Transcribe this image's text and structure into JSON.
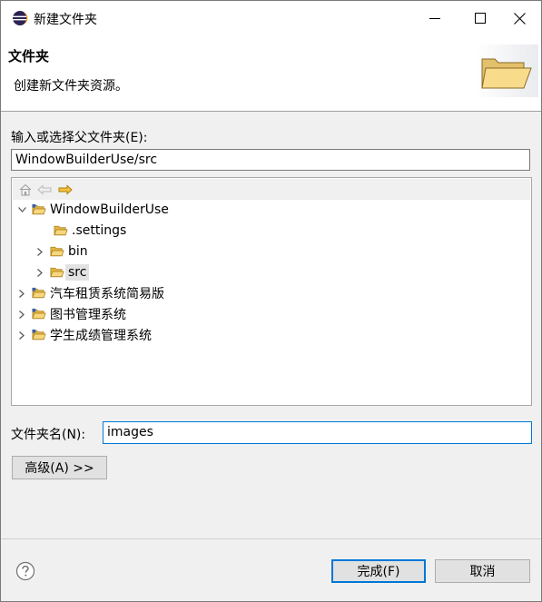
{
  "window": {
    "title": "新建文件夹"
  },
  "banner": {
    "title": "文件夹",
    "description": "创建新文件夹资源。"
  },
  "parent": {
    "label": "输入或选择父文件夹(E):",
    "value": "WindowBuilderUse/src"
  },
  "tree": {
    "items": [
      {
        "label": "WindowBuilderUse",
        "expanded": true
      },
      {
        "label": ".settings"
      },
      {
        "label": "bin"
      },
      {
        "label": "src",
        "selected": true
      },
      {
        "label": "汽车租赁系统简易版"
      },
      {
        "label": "图书管理系统"
      },
      {
        "label": "学生成绩管理系统"
      }
    ]
  },
  "name_field": {
    "label": "文件夹名(N):",
    "value": "images"
  },
  "buttons": {
    "advanced": "高级(A) >>",
    "finish": "完成(F)",
    "cancel": "取消"
  },
  "colors": {
    "accent": "#0078d7",
    "folder": "#f4c55e",
    "folder_dark": "#c7962b",
    "nav_arrow": "#e8a81c"
  }
}
